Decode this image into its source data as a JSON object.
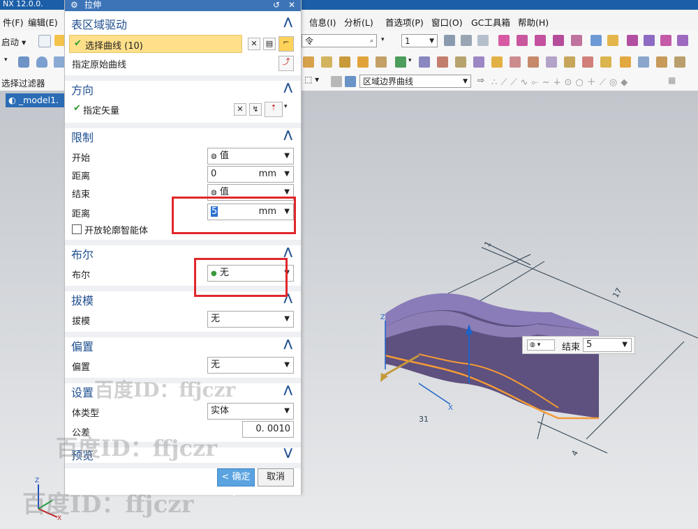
{
  "app": {
    "title": "NX 12.0.0."
  },
  "menubar": {
    "items": [
      "件(F)",
      "编辑(E)",
      "信息(I)",
      "分析(L)",
      "首选项(P)",
      "窗口(O)",
      "GC工具箱",
      "帮助(H)"
    ]
  },
  "toolbar": {
    "start_label": "启动",
    "command_search_placeholder": "令",
    "layer_value": "1",
    "filter_label": "选择过滤器",
    "curve_rule_value": "区域边界曲线"
  },
  "model_tab": {
    "label": "_model1."
  },
  "dialog": {
    "title": "拉伸",
    "sections": {
      "region": {
        "title": "表区域驱动",
        "select_curve": "选择曲线 (10)",
        "original_curve": "指定原始曲线"
      },
      "direction": {
        "title": "方向",
        "vector": "指定矢量"
      },
      "limits": {
        "title": "限制",
        "start_label": "开始",
        "start_value": "值",
        "distance_label": "距离",
        "distance_value": "0",
        "distance_unit": "mm",
        "end_label": "结束",
        "end_value": "值",
        "end_distance_label": "距离",
        "end_distance_value": "5",
        "end_distance_unit": "mm",
        "open_profile": "开放轮廓智能体"
      },
      "boolean": {
        "title": "布尔",
        "label": "布尔",
        "value": "无"
      },
      "draft": {
        "title": "拔模",
        "label": "拔模",
        "value": "无"
      },
      "offset": {
        "title": "偏置",
        "label": "偏置",
        "value": "无"
      },
      "settings": {
        "title": "设置",
        "body_type_label": "体类型",
        "body_type_value": "实体",
        "tolerance_label": "公差",
        "tolerance_value": "0. 0010"
      },
      "preview": {
        "title": "预览"
      }
    },
    "ok_label": "< 确定 >",
    "cancel_label": "取消"
  },
  "onscreen": {
    "end_label": "结束",
    "end_value": "5"
  },
  "watermark": {
    "text": "百度ID：ffjczr"
  },
  "colors": {
    "accent": "#1f4f8f",
    "highlight": "#ffe08a",
    "annotation": "#e0272b",
    "solid": "#6a5c92",
    "edge": "#f39a35"
  }
}
